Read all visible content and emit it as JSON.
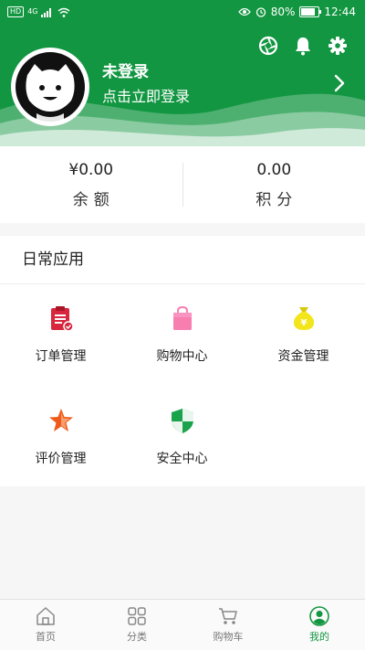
{
  "status_bar": {
    "hd": "HD",
    "network": "4G",
    "battery": "80%",
    "battery_level": 0.8,
    "time": "12:44"
  },
  "profile": {
    "name": "未登录",
    "prompt": "点击立即登录"
  },
  "balance": {
    "amount_value": "¥0.00",
    "amount_label": "余额",
    "points_value": "0.00",
    "points_label": "积分"
  },
  "daily_apps": {
    "title": "日常应用",
    "items": [
      {
        "label": "订单管理",
        "icon": "clipboard-icon",
        "color": "#d7263d"
      },
      {
        "label": "购物中心",
        "icon": "shopping-bag-icon",
        "color": "#f77fb0"
      },
      {
        "label": "资金管理",
        "icon": "money-bag-icon",
        "color": "#f3e51b"
      },
      {
        "label": "评价管理",
        "icon": "star-icon",
        "color": "#f05a1a"
      },
      {
        "label": "安全中心",
        "icon": "shield-icon",
        "color": "#1aa34a"
      }
    ]
  },
  "bottom_nav": {
    "items": [
      {
        "label": "首页",
        "icon": "home-icon"
      },
      {
        "label": "分类",
        "icon": "grid-icon"
      },
      {
        "label": "购物车",
        "icon": "cart-icon"
      },
      {
        "label": "我的",
        "icon": "user-icon",
        "active": true
      }
    ]
  },
  "colors": {
    "brand": "#129641"
  }
}
